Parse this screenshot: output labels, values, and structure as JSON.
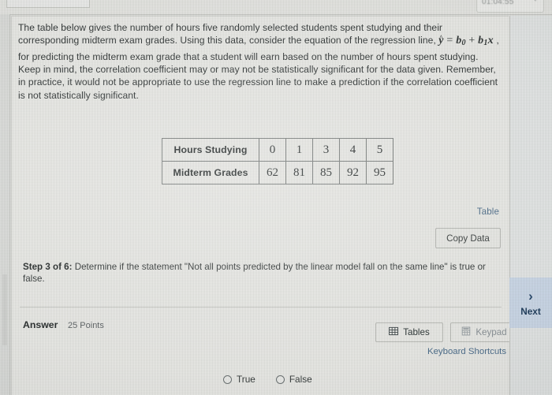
{
  "window": {
    "timer": "01:04:55",
    "timer_icon": "speaker-icon"
  },
  "question": {
    "paragraph_part1": "The table below gives the number of hours five randomly selected students spent studying and their corresponding midterm exam grades. Using this data, consider the equation of the regression line,",
    "formula": {
      "y_hat": "y",
      "hat": "^",
      "equals": "=",
      "b0": "b",
      "b0_sub": "0",
      "plus": "+",
      "b1": "b",
      "b1_sub": "1",
      "x": "x"
    },
    "paragraph_part2": ", for predicting the midterm exam grade that a student will earn based on the number of hours spent studying. Keep in mind, the correlation coefficient may or may not be statistically significant for the data given. Remember, in practice, it would not be appropriate to use the regression line to make a prediction if the correlation coefficient is not statistically significant."
  },
  "data_table": {
    "rows": [
      {
        "header": "Hours Studying",
        "cells": [
          "0",
          "1",
          "3",
          "4",
          "5"
        ]
      },
      {
        "header": "Midterm Grades",
        "cells": [
          "62",
          "81",
          "85",
          "92",
          "95"
        ]
      }
    ]
  },
  "table_tools": {
    "table_label": "Table",
    "copy_data_label": "Copy Data"
  },
  "step": {
    "label": "Step 3 of 6:",
    "text": " Determine if the statement \"Not all points predicted by the linear model fall on the same line\" is true or false."
  },
  "answer": {
    "label": "Answer",
    "points": "25 Points",
    "tables_button": "Tables",
    "keypad_button": "Keypad",
    "keyboard_shortcuts": "Keyboard Shortcuts",
    "options": [
      {
        "label": "True",
        "selected": false
      },
      {
        "label": "False",
        "selected": false
      }
    ]
  },
  "sidebar": {
    "next_label": "Next",
    "next_icon": "chevron-right-icon"
  },
  "colors": {
    "accent_blue": "#4f6f8d",
    "next_panel": "#ccd8e8",
    "next_text": "#23405f",
    "page_bg": "#eaeae7",
    "text": "#353a3a"
  }
}
